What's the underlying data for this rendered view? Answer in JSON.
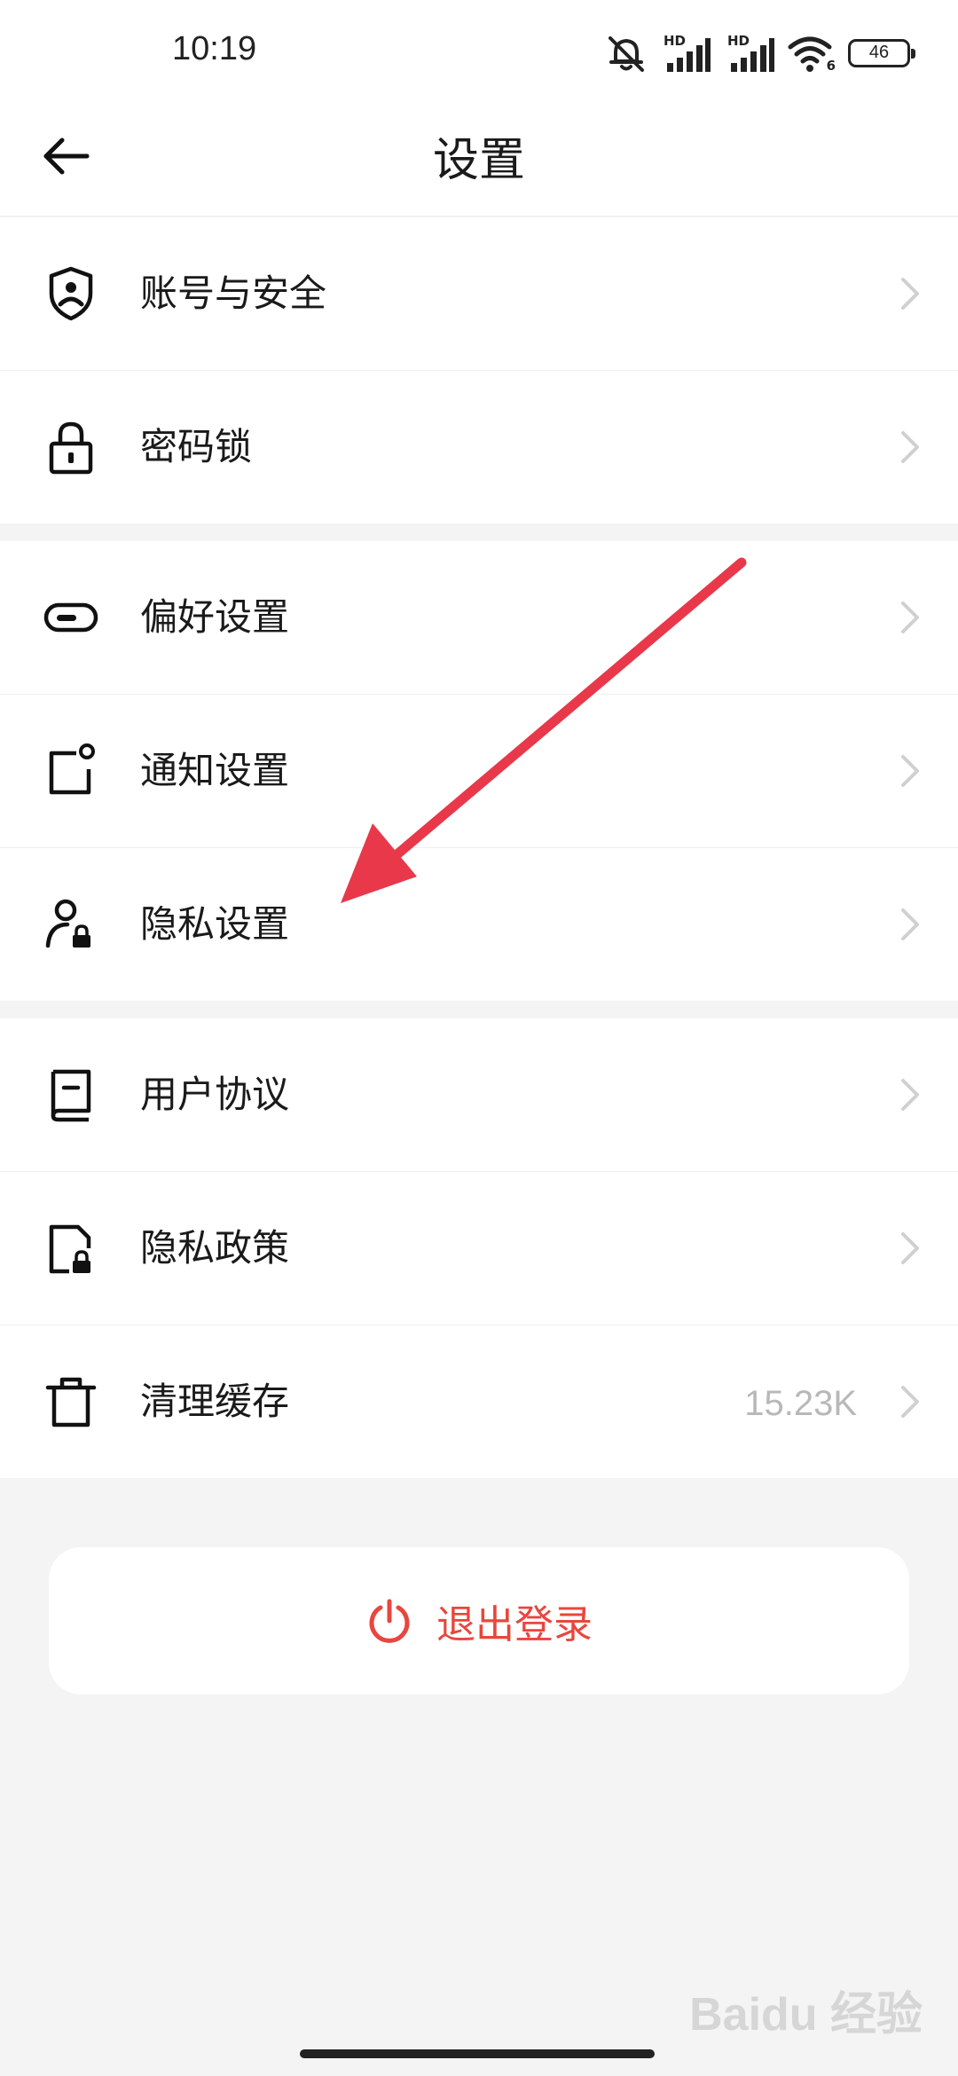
{
  "status_bar": {
    "time": "10:19",
    "hd1": "HD",
    "hd2": "HD",
    "wifi_sub": "6",
    "battery": "46"
  },
  "header": {
    "title": "设置"
  },
  "groups": [
    {
      "items": [
        {
          "label": "账号与安全",
          "icon": "shield-user-icon"
        },
        {
          "label": "密码锁",
          "icon": "padlock-icon"
        }
      ]
    },
    {
      "items": [
        {
          "label": "偏好设置",
          "icon": "toggle-icon"
        },
        {
          "label": "通知设置",
          "icon": "notification-icon"
        },
        {
          "label": "隐私设置",
          "icon": "user-lock-icon"
        }
      ]
    },
    {
      "items": [
        {
          "label": "用户协议",
          "icon": "book-icon"
        },
        {
          "label": "隐私政策",
          "icon": "document-lock-icon"
        },
        {
          "label": "清理缓存",
          "icon": "trash-icon",
          "value": "15.23K"
        }
      ]
    }
  ],
  "logout": {
    "label": "退出登录",
    "color": "#e8463e"
  },
  "watermark": "Baidu 经验"
}
